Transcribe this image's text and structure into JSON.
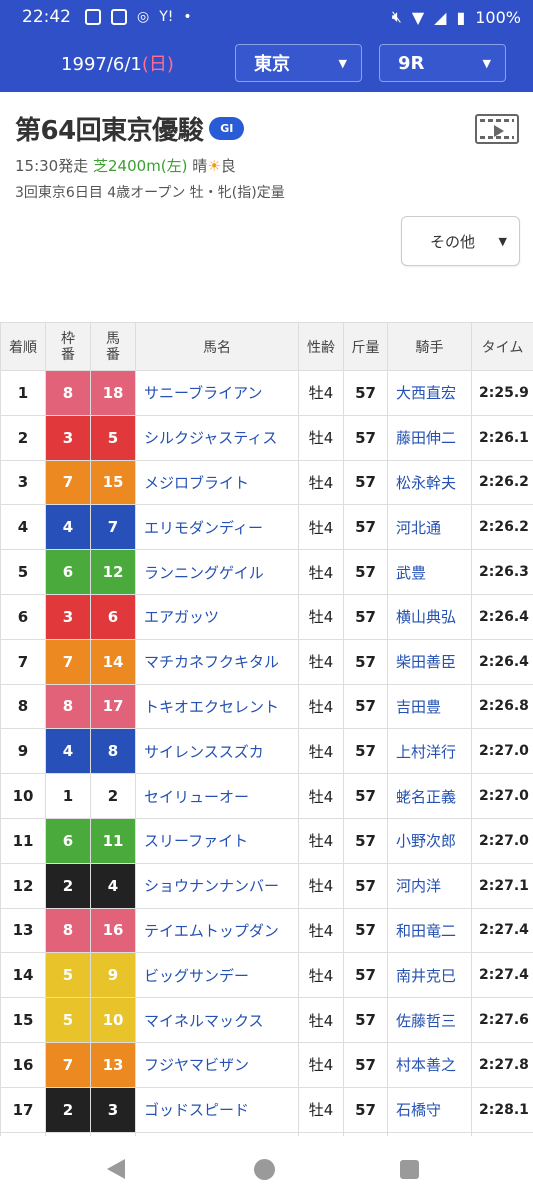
{
  "status_bar": {
    "time": "22:42",
    "battery": "100%"
  },
  "header": {
    "date": "1997/6/1",
    "weekday": "(日)",
    "track_select": "東京",
    "race_select": "9R"
  },
  "race": {
    "title": "第64回東京優駿",
    "grade": "GI",
    "start_time": "15:30発走",
    "course": "芝2400m(左)",
    "weather": "晴",
    "going": "良",
    "details": "3回東京6日目  4歳オープン 牡・牝(指)定量"
  },
  "other_button": "その他",
  "table": {
    "headers": {
      "rank": "着順",
      "waku_top": "枠",
      "waku_bottom": "番",
      "umaban_top": "馬",
      "umaban_bottom": "番",
      "horse": "馬名",
      "sex_age": "性齢",
      "weight": "斤量",
      "jockey": "騎手",
      "time": "タイム"
    },
    "rows": [
      {
        "rank": "1",
        "waku": "8",
        "umaban": "18",
        "horse": "サニーブライアン",
        "sex_age": "牡4",
        "weight": "57",
        "jockey": "大西直宏",
        "time": "2:25.9"
      },
      {
        "rank": "2",
        "waku": "3",
        "umaban": "5",
        "horse": "シルクジャスティス",
        "sex_age": "牡4",
        "weight": "57",
        "jockey": "藤田伸二",
        "time": "2:26.1"
      },
      {
        "rank": "3",
        "waku": "7",
        "umaban": "15",
        "horse": "メジロブライト",
        "sex_age": "牡4",
        "weight": "57",
        "jockey": "松永幹夫",
        "time": "2:26.2"
      },
      {
        "rank": "4",
        "waku": "4",
        "umaban": "7",
        "horse": "エリモダンディー",
        "sex_age": "牡4",
        "weight": "57",
        "jockey": "河北通",
        "time": "2:26.2"
      },
      {
        "rank": "5",
        "waku": "6",
        "umaban": "12",
        "horse": "ランニングゲイル",
        "sex_age": "牡4",
        "weight": "57",
        "jockey": "武豊",
        "time": "2:26.3"
      },
      {
        "rank": "6",
        "waku": "3",
        "umaban": "6",
        "horse": "エアガッツ",
        "sex_age": "牡4",
        "weight": "57",
        "jockey": "横山典弘",
        "time": "2:26.4"
      },
      {
        "rank": "7",
        "waku": "7",
        "umaban": "14",
        "horse": "マチカネフクキタル",
        "sex_age": "牡4",
        "weight": "57",
        "jockey": "柴田善臣",
        "time": "2:26.4"
      },
      {
        "rank": "8",
        "waku": "8",
        "umaban": "17",
        "horse": "トキオエクセレント",
        "sex_age": "牡4",
        "weight": "57",
        "jockey": "吉田豊",
        "time": "2:26.8"
      },
      {
        "rank": "9",
        "waku": "4",
        "umaban": "8",
        "horse": "サイレンススズカ",
        "sex_age": "牡4",
        "weight": "57",
        "jockey": "上村洋行",
        "time": "2:27.0"
      },
      {
        "rank": "10",
        "waku": "1",
        "umaban": "2",
        "horse": "セイリューオー",
        "sex_age": "牡4",
        "weight": "57",
        "jockey": "蛯名正義",
        "time": "2:27.0"
      },
      {
        "rank": "11",
        "waku": "6",
        "umaban": "11",
        "horse": "スリーファイト",
        "sex_age": "牡4",
        "weight": "57",
        "jockey": "小野次郎",
        "time": "2:27.0"
      },
      {
        "rank": "12",
        "waku": "2",
        "umaban": "4",
        "horse": "ショウナンナンバー",
        "sex_age": "牡4",
        "weight": "57",
        "jockey": "河内洋",
        "time": "2:27.1"
      },
      {
        "rank": "13",
        "waku": "8",
        "umaban": "16",
        "horse": "テイエムトップダン",
        "sex_age": "牡4",
        "weight": "57",
        "jockey": "和田竜二",
        "time": "2:27.4"
      },
      {
        "rank": "14",
        "waku": "5",
        "umaban": "9",
        "horse": "ビッグサンデー",
        "sex_age": "牡4",
        "weight": "57",
        "jockey": "南井克巳",
        "time": "2:27.4"
      },
      {
        "rank": "15",
        "waku": "5",
        "umaban": "10",
        "horse": "マイネルマックス",
        "sex_age": "牡4",
        "weight": "57",
        "jockey": "佐藤哲三",
        "time": "2:27.6"
      },
      {
        "rank": "16",
        "waku": "7",
        "umaban": "13",
        "horse": "フジヤマビザン",
        "sex_age": "牡4",
        "weight": "57",
        "jockey": "村本善之",
        "time": "2:27.8"
      },
      {
        "rank": "17",
        "waku": "2",
        "umaban": "3",
        "horse": "ゴッドスピード",
        "sex_age": "牡4",
        "weight": "57",
        "jockey": "石橋守",
        "time": "2:28.1"
      }
    ]
  },
  "colors": {
    "header_blue": "#3050c8",
    "link_blue": "#2451b3",
    "turf_green": "#3c9f2f"
  }
}
